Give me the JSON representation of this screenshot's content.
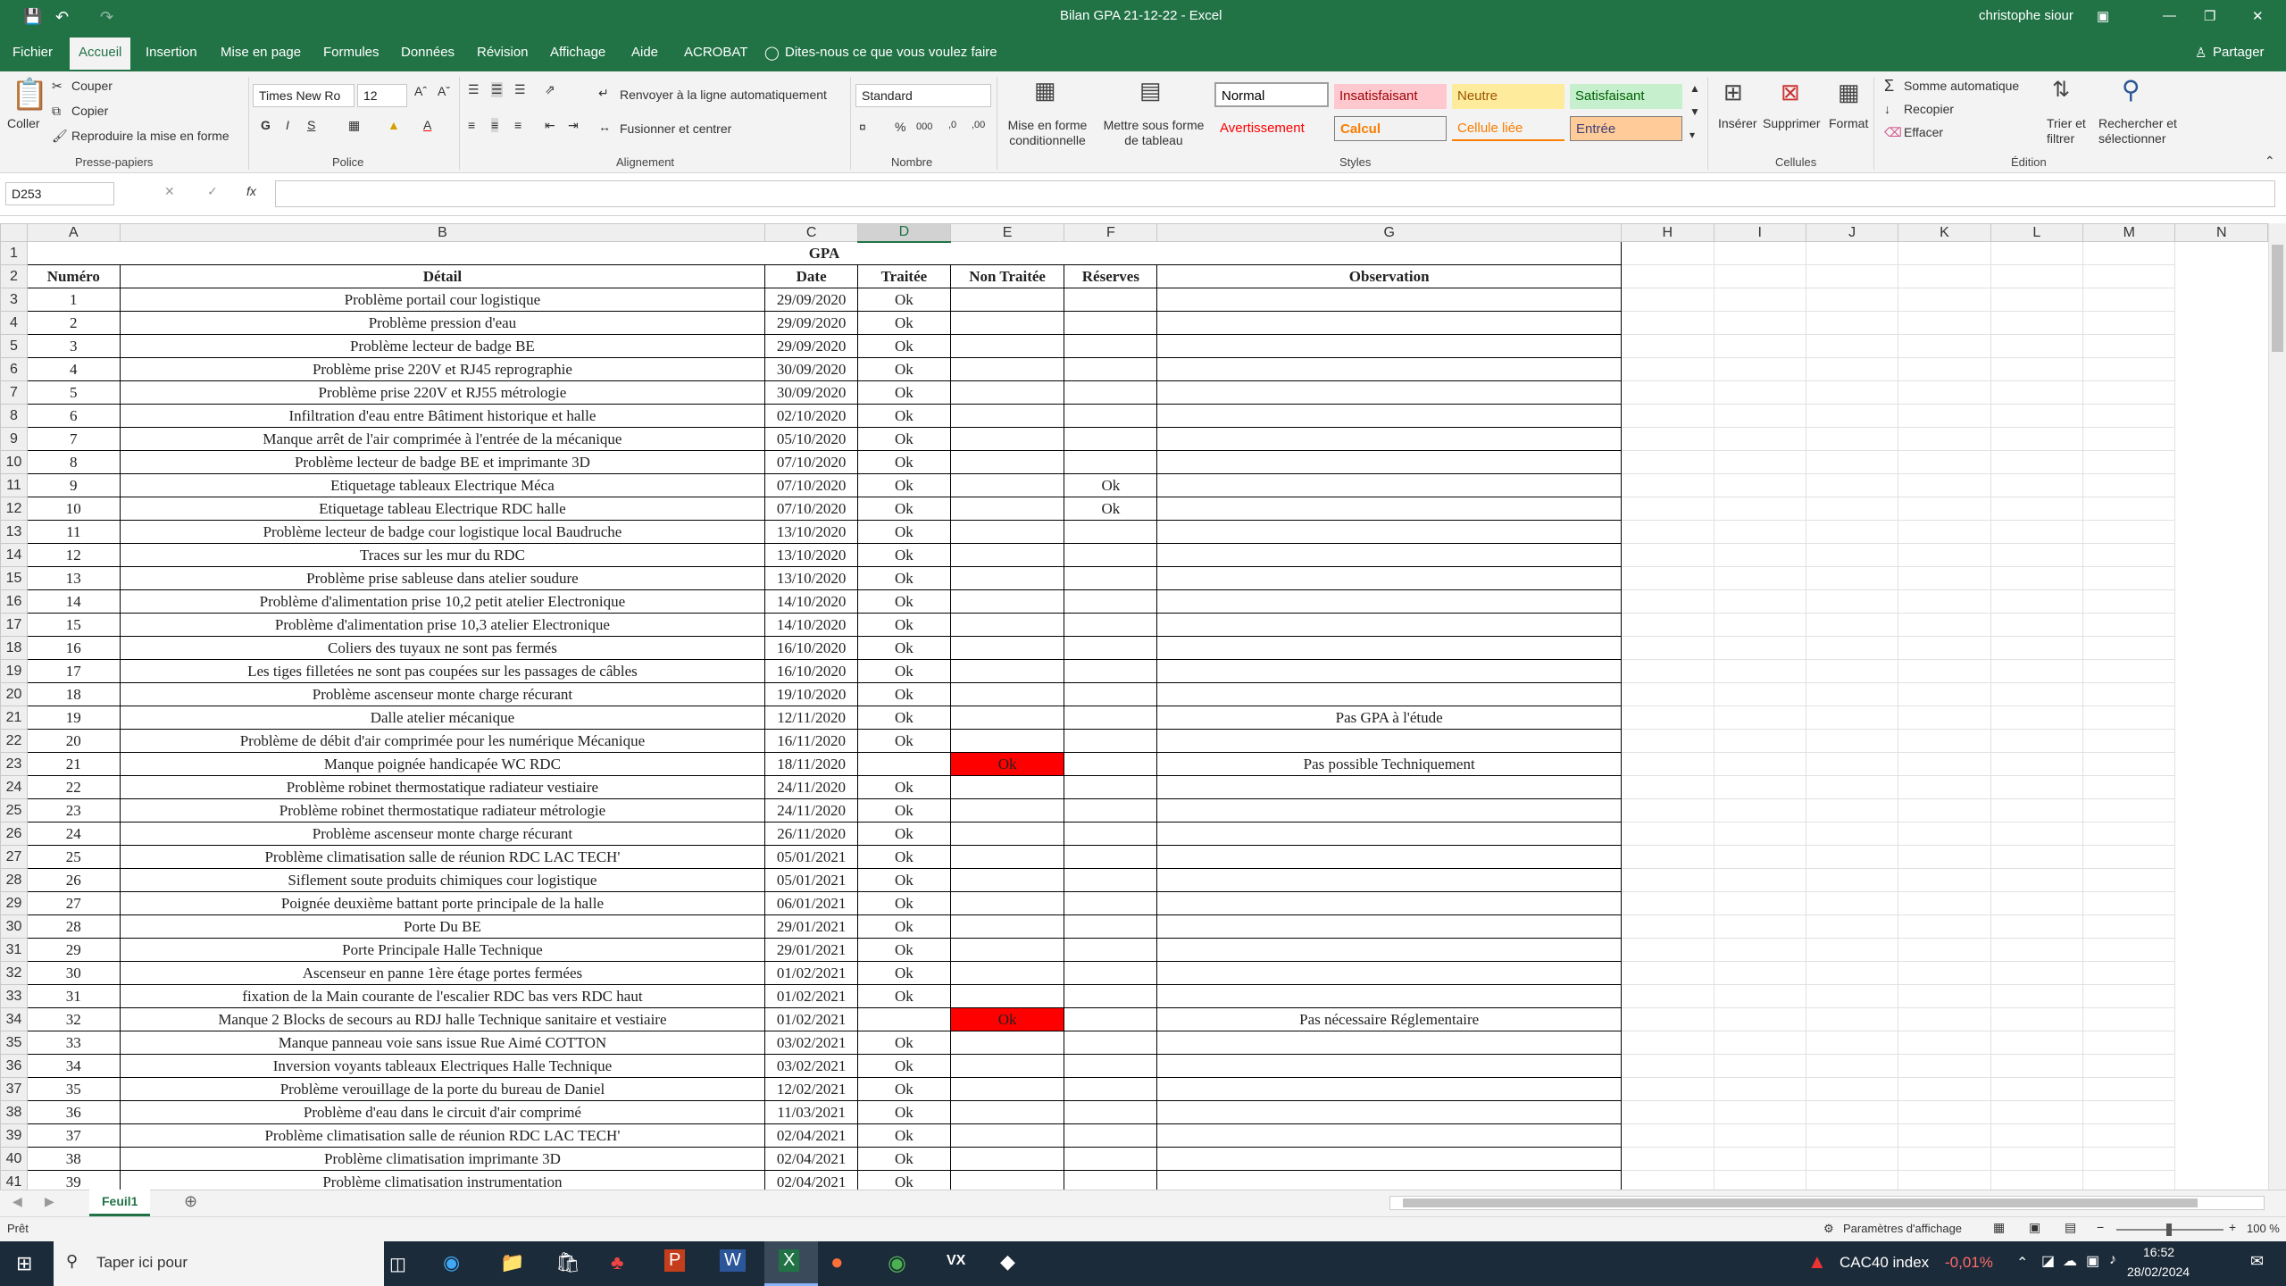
{
  "app": {
    "title": "Bilan GPA 21-12-22  -  Excel",
    "user": "christophe siour"
  },
  "tabs": [
    "Fichier",
    "Accueil",
    "Insertion",
    "Mise en page",
    "Formules",
    "Données",
    "Révision",
    "Affichage",
    "Aide",
    "ACROBAT",
    "Dites-nous ce que vous voulez faire"
  ],
  "share_label": "Partager",
  "ribbon": {
    "clipboard": {
      "coller": "Coller",
      "couper": "Couper",
      "copier": "Copier",
      "reproduire": "Reproduire la mise en forme",
      "group": "Presse-papiers"
    },
    "font": {
      "name": "Times New Ro",
      "size": "12",
      "group": "Police"
    },
    "alignment": {
      "wrap": "Renvoyer à la ligne automatiquement",
      "merge": "Fusionner et centrer",
      "group": "Alignement"
    },
    "number": {
      "format": "Standard",
      "group": "Nombre"
    },
    "styles": {
      "cond": "Mise en forme conditionnelle",
      "table": "Mettre sous forme de tableau",
      "group": "Styles",
      "cells": [
        {
          "label": "Normal",
          "bg": "#ffffff",
          "fg": "#000000"
        },
        {
          "label": "Insatisfaisant",
          "bg": "#ffc7ce",
          "fg": "#9c0006"
        },
        {
          "label": "Neutre",
          "bg": "#ffeb9c",
          "fg": "#9c5700"
        },
        {
          "label": "Satisfaisant",
          "bg": "#c6efce",
          "fg": "#006100"
        },
        {
          "label": "Avertissement",
          "bg": "#f3f3f3",
          "fg": "#ff0000"
        },
        {
          "label": "Calcul",
          "bg": "#f2f2f2",
          "fg": "#fa7d00"
        },
        {
          "label": "Cellule liée",
          "bg": "#f3f3f3",
          "fg": "#fa7d00"
        },
        {
          "label": "Entrée",
          "bg": "#ffcc99",
          "fg": "#3f3f76"
        }
      ]
    },
    "cells": {
      "inserer": "Insérer",
      "supprimer": "Supprimer",
      "format": "Format",
      "group": "Cellules"
    },
    "edition": {
      "somme": "Somme automatique",
      "recopier": "Recopier",
      "effacer": "Effacer",
      "trier": "Trier et filtrer",
      "rechercher": "Rechercher et sélectionner",
      "group": "Édition"
    }
  },
  "formula": {
    "namebox": "D253",
    "fx": "fx",
    "value": ""
  },
  "columns": [
    "A",
    "B",
    "C",
    "D",
    "E",
    "F",
    "G",
    "H",
    "I",
    "J",
    "K",
    "L",
    "M",
    "N"
  ],
  "sheet": {
    "title": "GPA",
    "headers": [
      "Numéro",
      "Détail",
      "Date",
      "Traitée",
      "Non Traitée",
      "Réserves",
      "Observation"
    ],
    "rows": [
      {
        "n": "1",
        "d": "Problème portail cour logistique",
        "date": "29/09/2020",
        "t": "Ok",
        "nt": "",
        "r": "",
        "o": ""
      },
      {
        "n": "2",
        "d": "Problème pression d'eau",
        "date": "29/09/2020",
        "t": "Ok",
        "nt": "",
        "r": "",
        "o": ""
      },
      {
        "n": "3",
        "d": "Problème lecteur de badge BE",
        "date": "29/09/2020",
        "t": "Ok",
        "nt": "",
        "r": "",
        "o": ""
      },
      {
        "n": "4",
        "d": "Problème prise 220V et RJ45 reprographie",
        "date": "30/09/2020",
        "t": "Ok",
        "nt": "",
        "r": "",
        "o": ""
      },
      {
        "n": "5",
        "d": "Problème prise 220V et RJ55 métrologie",
        "date": "30/09/2020",
        "t": "Ok",
        "nt": "",
        "r": "",
        "o": ""
      },
      {
        "n": "6",
        "d": "Infiltration d'eau entre Bâtiment historique et halle",
        "date": "02/10/2020",
        "t": "Ok",
        "nt": "",
        "r": "",
        "o": ""
      },
      {
        "n": "7",
        "d": "Manque arrêt de l'air comprimée à l'entrée de la mécanique",
        "date": "05/10/2020",
        "t": "Ok",
        "nt": "",
        "r": "",
        "o": ""
      },
      {
        "n": "8",
        "d": "Problème lecteur de badge BE et imprimante 3D",
        "date": "07/10/2020",
        "t": "Ok",
        "nt": "",
        "r": "",
        "o": ""
      },
      {
        "n": "9",
        "d": "Etiquetage tableaux Electrique Méca",
        "date": "07/10/2020",
        "t": "Ok",
        "nt": "",
        "r": "Ok",
        "o": ""
      },
      {
        "n": "10",
        "d": "Etiquetage tableau Electrique RDC halle",
        "date": "07/10/2020",
        "t": "Ok",
        "nt": "",
        "r": "Ok",
        "o": ""
      },
      {
        "n": "11",
        "d": "Problème lecteur de badge cour logistique local Baudruche",
        "date": "13/10/2020",
        "t": "Ok",
        "nt": "",
        "r": "",
        "o": ""
      },
      {
        "n": "12",
        "d": "Traces sur les mur du RDC",
        "date": "13/10/2020",
        "t": "Ok",
        "nt": "",
        "r": "",
        "o": ""
      },
      {
        "n": "13",
        "d": "Problème prise sableuse dans atelier soudure",
        "date": "13/10/2020",
        "t": "Ok",
        "nt": "",
        "r": "",
        "o": ""
      },
      {
        "n": "14",
        "d": "Problème d'alimentation prise 10,2 petit atelier Electronique",
        "date": "14/10/2020",
        "t": "Ok",
        "nt": "",
        "r": "",
        "o": ""
      },
      {
        "n": "15",
        "d": "Problème d'alimentation prise 10,3 atelier Electronique",
        "date": "14/10/2020",
        "t": "Ok",
        "nt": "",
        "r": "",
        "o": ""
      },
      {
        "n": "16",
        "d": "Coliers des tuyaux ne sont pas fermés",
        "date": "16/10/2020",
        "t": "Ok",
        "nt": "",
        "r": "",
        "o": ""
      },
      {
        "n": "17",
        "d": "Les tiges filletées ne sont pas coupées sur les passages de câbles",
        "date": "16/10/2020",
        "t": "Ok",
        "nt": "",
        "r": "",
        "o": ""
      },
      {
        "n": "18",
        "d": "Problème ascenseur monte charge récurant",
        "date": "19/10/2020",
        "t": "Ok",
        "nt": "",
        "r": "",
        "o": ""
      },
      {
        "n": "19",
        "d": "Dalle atelier mécanique",
        "date": "12/11/2020",
        "t": "Ok",
        "nt": "",
        "r": "",
        "o": "Pas GPA à l'étude"
      },
      {
        "n": "20",
        "d": "Problème de débit d'air comprimée pour les numérique Mécanique",
        "date": "16/11/2020",
        "t": "Ok",
        "nt": "",
        "r": "",
        "o": ""
      },
      {
        "n": "21",
        "d": "Manque poignée handicapée WC RDC",
        "date": "18/11/2020",
        "t": "",
        "nt": "Ok",
        "r": "",
        "o": "Pas possible Techniquement"
      },
      {
        "n": "22",
        "d": "Problème robinet thermostatique radiateur vestiaire",
        "date": "24/11/2020",
        "t": "Ok",
        "nt": "",
        "r": "",
        "o": ""
      },
      {
        "n": "23",
        "d": "Problème robinet thermostatique radiateur métrologie",
        "date": "24/11/2020",
        "t": "Ok",
        "nt": "",
        "r": "",
        "o": ""
      },
      {
        "n": "24",
        "d": "Problème ascenseur monte charge récurant",
        "date": "26/11/2020",
        "t": "Ok",
        "nt": "",
        "r": "",
        "o": ""
      },
      {
        "n": "25",
        "d": "Problème climatisation salle de réunion RDC LAC TECH'",
        "date": "05/01/2021",
        "t": "Ok",
        "nt": "",
        "r": "",
        "o": ""
      },
      {
        "n": "26",
        "d": "Siflement soute produits chimiques cour logistique",
        "date": "05/01/2021",
        "t": "Ok",
        "nt": "",
        "r": "",
        "o": ""
      },
      {
        "n": "27",
        "d": "Poignée deuxième battant porte principale de la halle",
        "date": "06/01/2021",
        "t": "Ok",
        "nt": "",
        "r": "",
        "o": ""
      },
      {
        "n": "28",
        "d": "Porte Du BE",
        "date": "29/01/2021",
        "t": "Ok",
        "nt": "",
        "r": "",
        "o": ""
      },
      {
        "n": "29",
        "d": "Porte Principale Halle Technique",
        "date": "29/01/2021",
        "t": "Ok",
        "nt": "",
        "r": "",
        "o": ""
      },
      {
        "n": "30",
        "d": "Ascenseur en panne 1ère étage portes fermées",
        "date": "01/02/2021",
        "t": "Ok",
        "nt": "",
        "r": "",
        "o": ""
      },
      {
        "n": "31",
        "d": "fixation de la Main courante de l'escalier RDC bas vers RDC haut",
        "date": "01/02/2021",
        "t": "Ok",
        "nt": "",
        "r": "",
        "o": ""
      },
      {
        "n": "32",
        "d": "Manque 2 Blocks de secours au RDJ halle Technique sanitaire et vestiaire",
        "date": "01/02/2021",
        "t": "",
        "nt": "Ok",
        "r": "",
        "o": "Pas nécessaire Réglementaire"
      },
      {
        "n": "33",
        "d": "Manque panneau voie sans issue Rue Aimé COTTON",
        "date": "03/02/2021",
        "t": "Ok",
        "nt": "",
        "r": "",
        "o": ""
      },
      {
        "n": "34",
        "d": "Inversion voyants tableaux Electriques Halle Technique",
        "date": "03/02/2021",
        "t": "Ok",
        "nt": "",
        "r": "",
        "o": ""
      },
      {
        "n": "35",
        "d": "Problème verouillage de la porte du bureau de Daniel",
        "date": "12/02/2021",
        "t": "Ok",
        "nt": "",
        "r": "",
        "o": ""
      },
      {
        "n": "36",
        "d": "Problème d'eau dans le circuit d'air comprimé",
        "date": "11/03/2021",
        "t": "Ok",
        "nt": "",
        "r": "",
        "o": ""
      },
      {
        "n": "37",
        "d": "Problème climatisation salle de réunion RDC LAC TECH'",
        "date": "02/04/2021",
        "t": "Ok",
        "nt": "",
        "r": "",
        "o": ""
      },
      {
        "n": "38",
        "d": "Problème climatisation imprimante 3D",
        "date": "02/04/2021",
        "t": "Ok",
        "nt": "",
        "r": "",
        "o": ""
      },
      {
        "n": "39",
        "d": "Problème climatisation instrumentation",
        "date": "02/04/2021",
        "t": "Ok",
        "nt": "",
        "r": "",
        "o": ""
      }
    ]
  },
  "sheet_tab": "Feuil1",
  "status": {
    "ready": "Prêt",
    "display_settings": "Paramètres d'affichage",
    "zoom": "100 %"
  },
  "taskbar": {
    "search": "Taper ici pour",
    "ticker": "CAC40 index",
    "change": "-0,01%",
    "time": "16:52",
    "date": "28/02/2024"
  }
}
